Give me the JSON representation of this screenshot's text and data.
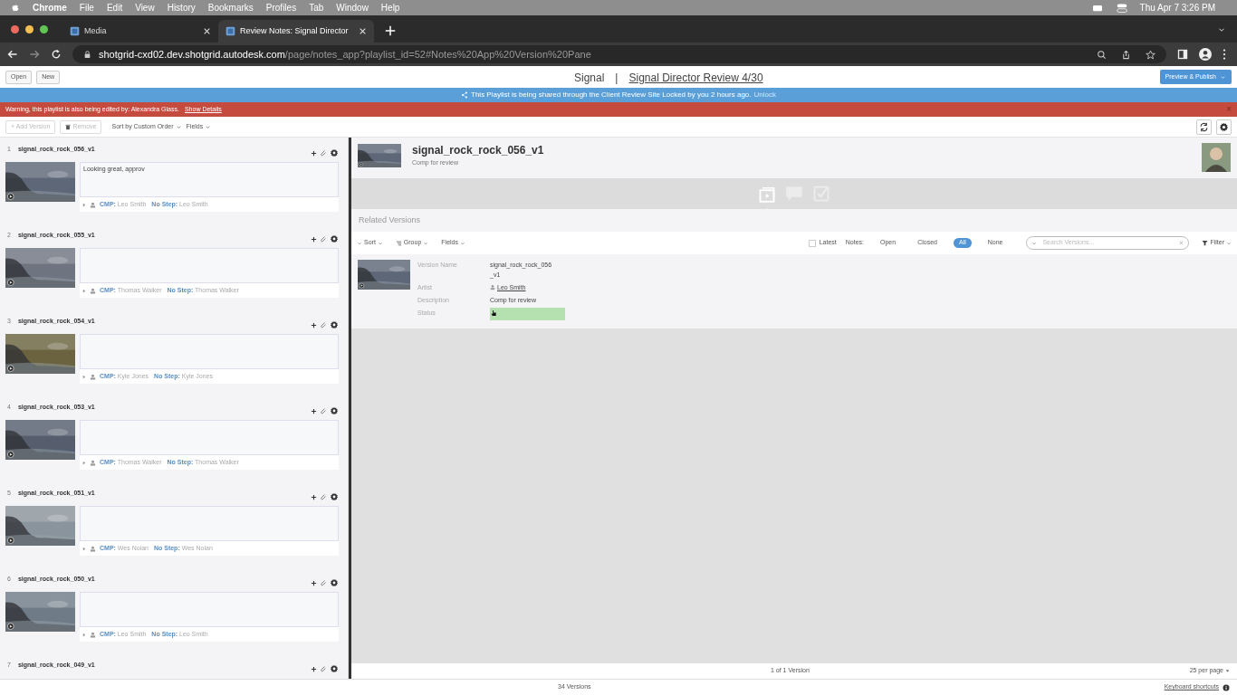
{
  "menu_bar": {
    "app": "Chrome",
    "items": [
      "File",
      "Edit",
      "View",
      "History",
      "Bookmarks",
      "Profiles",
      "Tab",
      "Window",
      "Help"
    ],
    "clock": "Thu Apr 7  3:26 PM"
  },
  "browser_tabs": [
    {
      "title": "Media",
      "selected": false
    },
    {
      "title": "Review Notes: Signal Director",
      "selected": true
    }
  ],
  "address": {
    "host": "shotgrid-cxd02.dev.shotgrid.autodesk.com",
    "path": "/page/notes_app?playlist_id=52#Notes%20App%20Version%20Pane"
  },
  "app_header": {
    "buttons": [
      "Open",
      "New"
    ],
    "project": "Signal",
    "separator": "|",
    "playlist": "Signal Director Review 4/30",
    "publish_button": "Preview & Publish"
  },
  "share_banner": {
    "text": "This Playlist is being shared through the Client Review Site Locked by you 2 hours ago.",
    "link": "Unlock"
  },
  "warning_banner": {
    "text": "Warning, this playlist is also being edited by: Alexandra Glass.",
    "link": "Show Details",
    "close": "×"
  },
  "toolbar": {
    "add": "+ Add Version",
    "remove": "Remove",
    "sort": "Sort by Custom Order",
    "fields": "Fields"
  },
  "versions": [
    {
      "number": "1",
      "name": "signal_rock_rock_056_v1",
      "note": "Looking great, approv",
      "credits": [
        {
          "label": "CMP:",
          "name": "Leo Smith"
        },
        {
          "label": "No Step:",
          "name": "Leo Smith"
        }
      ]
    },
    {
      "number": "2",
      "name": "signal_rock_rock_055_v1",
      "credits": [
        {
          "label": "CMP:",
          "name": "Thomas Walker"
        },
        {
          "label": "No Step:",
          "name": "Thomas Walker"
        }
      ]
    },
    {
      "number": "3",
      "name": "signal_rock_rock_054_v1",
      "credits": [
        {
          "label": "CMP:",
          "name": "Kyle Jones"
        },
        {
          "label": "No Step:",
          "name": "Kyle Jones"
        }
      ]
    },
    {
      "number": "4",
      "name": "signal_rock_rock_053_v1",
      "credits": [
        {
          "label": "CMP:",
          "name": "Thomas Walker"
        },
        {
          "label": "No Step:",
          "name": "Thomas Walker"
        }
      ]
    },
    {
      "number": "5",
      "name": "signal_rock_rock_051_v1",
      "credits": [
        {
          "label": "CMP:",
          "name": "Wes Nolan"
        },
        {
          "label": "No Step:",
          "name": "Wes Nolan"
        }
      ]
    },
    {
      "number": "6",
      "name": "signal_rock_rock_050_v1",
      "credits": [
        {
          "label": "CMP:",
          "name": "Leo Smith"
        },
        {
          "label": "No Step:",
          "name": "Leo Smith"
        }
      ]
    },
    {
      "number": "7",
      "name": "signal_rock_rock_049_v1"
    }
  ],
  "detail": {
    "title": "signal_rock_rock_056_v1",
    "subtitle": "Comp for review",
    "icon_tabs": [
      {
        "kind": "versions",
        "selected": true
      },
      {
        "kind": "notes",
        "selected": false
      },
      {
        "kind": "tasks",
        "selected": false
      }
    ],
    "section_title": "Related Versions",
    "controls": {
      "sort": "Sort",
      "group": "Group",
      "fields": "Fields",
      "latest": "Latest",
      "latest_checked": false,
      "notes_label": "Notes:",
      "search_placeholder": "Search Versions...",
      "filter": "Filter"
    },
    "note_filters": [
      {
        "label": "Open",
        "selected": false
      },
      {
        "label": "Closed",
        "selected": false
      },
      {
        "label": "All",
        "selected": true
      },
      {
        "label": "None",
        "selected": false
      }
    ],
    "card": {
      "fields": [
        {
          "label": "Version Name",
          "value": "signal_rock_rock_056\n_v1",
          "kind": "text"
        },
        {
          "label": "Artist",
          "value": "Leo Smith",
          "kind": "user"
        },
        {
          "label": "Description",
          "value": "Comp for review",
          "kind": "text"
        },
        {
          "label": "Status",
          "kind": "status",
          "color": "#b5e0b0"
        }
      ]
    },
    "pagination": "1 of 1 Version",
    "per_page": "25 per page"
  },
  "footer": {
    "count": "34 Versions",
    "shortcuts": "Keyboard shortcuts"
  }
}
